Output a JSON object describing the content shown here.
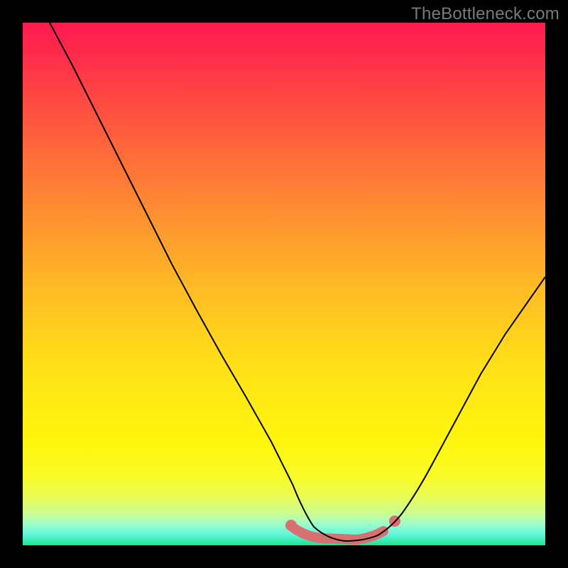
{
  "watermark": "TheBottleneck.com",
  "chart_data": {
    "type": "line",
    "title": "",
    "xlabel": "",
    "ylabel": "",
    "xlim": [
      0,
      100
    ],
    "ylim": [
      0,
      100
    ],
    "grid": false,
    "series": [
      {
        "name": "curve",
        "x": [
          0,
          5,
          10,
          15,
          20,
          25,
          30,
          35,
          40,
          45,
          50,
          54,
          57,
          60,
          63,
          66,
          70,
          75,
          80,
          85,
          90,
          95,
          100
        ],
        "y": [
          100,
          88,
          76,
          64,
          53,
          43,
          34,
          26,
          19,
          12,
          7,
          3,
          1.5,
          1,
          1,
          1.5,
          3,
          8,
          16,
          26,
          36,
          45,
          53
        ]
      }
    ],
    "highlight": {
      "name": "low-bottleneck-zone",
      "x_range": [
        51,
        71
      ],
      "y": 1
    },
    "background_gradient": {
      "stops": [
        {
          "pos": 0,
          "color": "#ff1a4d"
        },
        {
          "pos": 50,
          "color": "#ffd31c"
        },
        {
          "pos": 100,
          "color": "#19e58e"
        }
      ]
    }
  }
}
